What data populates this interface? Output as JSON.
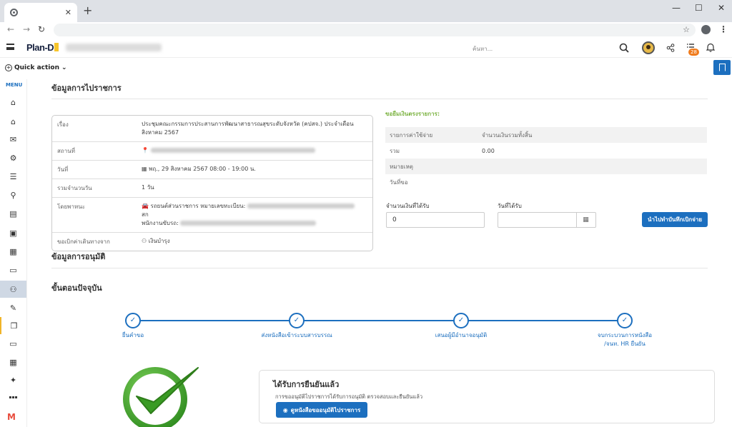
{
  "browser": {
    "tab_close": "✕",
    "new_tab": "+",
    "controls": {
      "minimize": "—",
      "maximize": "☐",
      "close": "✕"
    },
    "nav": {
      "back": "←",
      "forward": "→",
      "reload": "↻"
    }
  },
  "header": {
    "logo_text": "Plan-D",
    "search_placeholder": "ค้นหา...",
    "notification_count": "28"
  },
  "quick_action": {
    "label": "Quick action"
  },
  "sidebar": {
    "menu_label": "MENU",
    "items": [
      {
        "icon": "home-icon",
        "glyph": "⌂"
      },
      {
        "icon": "home-alt-icon",
        "glyph": "⌂"
      },
      {
        "icon": "mail-icon",
        "glyph": "✉"
      },
      {
        "icon": "settings-icon",
        "glyph": "⚙"
      },
      {
        "icon": "checklist-icon",
        "glyph": "☰"
      },
      {
        "icon": "user-location-icon",
        "glyph": "⚲"
      },
      {
        "icon": "document-icon",
        "glyph": "▤"
      },
      {
        "icon": "money-icon",
        "glyph": "▣"
      },
      {
        "icon": "calendar-plus-icon",
        "glyph": "▦"
      },
      {
        "icon": "card-icon",
        "glyph": "▭"
      },
      {
        "icon": "user-business-icon",
        "glyph": "⚇"
      },
      {
        "icon": "pen-icon",
        "glyph": "✎"
      },
      {
        "icon": "files-icon",
        "glyph": "❐"
      },
      {
        "icon": "monitor-icon",
        "glyph": "▭"
      },
      {
        "icon": "calendar-icon",
        "glyph": "▦"
      },
      {
        "icon": "magic-wand-icon",
        "glyph": "✦"
      },
      {
        "icon": "apps-grid-icon",
        "glyph": "▪▪▪"
      }
    ],
    "brand_mark": "M"
  },
  "section_trip": {
    "title": "ข้อมูลการไปราชการ"
  },
  "trip_info": {
    "rows": [
      {
        "label": "เรื่อง",
        "value": "ประชุมคณะกรรมการประสานการพัฒนาสาธารณสุขระดับจังหวัด (คปสจ.) ประจำเดือนสิงหาคม 2567"
      },
      {
        "label": "สถานที่",
        "value": ""
      },
      {
        "label": "วันที่",
        "value": "พฤ., 29 สิงหาคม 2567 08:00 - 19:00 น."
      },
      {
        "label": "รวมจำนวนวัน",
        "value": "1 วัน"
      },
      {
        "label": "โดยพาหนะ",
        "value": "รถยนต์ส่วนราชการ หมายเลขทะเบียน:",
        "value2": "สก",
        "value3": "พนักงานขับรถ:"
      },
      {
        "label": "ขอเบิกค่าเดินทางจาก",
        "value": "เงินบำรุง"
      }
    ]
  },
  "loan": {
    "title": "ขอยืมเงินตรงรายการ:",
    "rows": [
      {
        "c1": "รายการค่าใช้จ่าย",
        "c2": "จำนวนเงินรวมทั้งสิ้น"
      },
      {
        "c1": "รวม",
        "c2": "0.00"
      },
      {
        "c1": "หมายเหตุ",
        "c2": ""
      },
      {
        "c1": "วันที่ขอ",
        "c2": ""
      }
    ],
    "amount_label": "จำนวนเงินที่ได้รับ",
    "amount_value": "0",
    "date_label": "วันที่ได้รับ",
    "date_value": "",
    "submit_label": "นำไปทำบันทึกเบิกจ่าย"
  },
  "section_approval": {
    "title": "ข้อมูลการอนุมัติ"
  },
  "section_steps": {
    "title": "ขั้นตอนปัจจุบัน"
  },
  "steps": [
    {
      "label": "ยื่นคำขอ",
      "label2": ""
    },
    {
      "label": "ส่งหนังสือเข้าระบบสารบรรณ",
      "label2": ""
    },
    {
      "label": "เสนอผู้มีอำนาจอนุมัติ",
      "label2": ""
    },
    {
      "label": "จบกระบวนการหนังสือ",
      "label2": "/จนท. HR ยืนยัน"
    }
  ],
  "approval_card": {
    "title": "ได้รับการยืนยันแล้ว",
    "desc": "การขออนุมัติไปราชการได้รับการอนุมัติ ตรวจสอบและยืนยันแล้ว",
    "button_label": "ดูหนังสือขออนุมัติไปราชการ"
  },
  "colors": {
    "accent": "#1c6fbf",
    "success": "#7cb342",
    "badge": "#f07b1c"
  }
}
